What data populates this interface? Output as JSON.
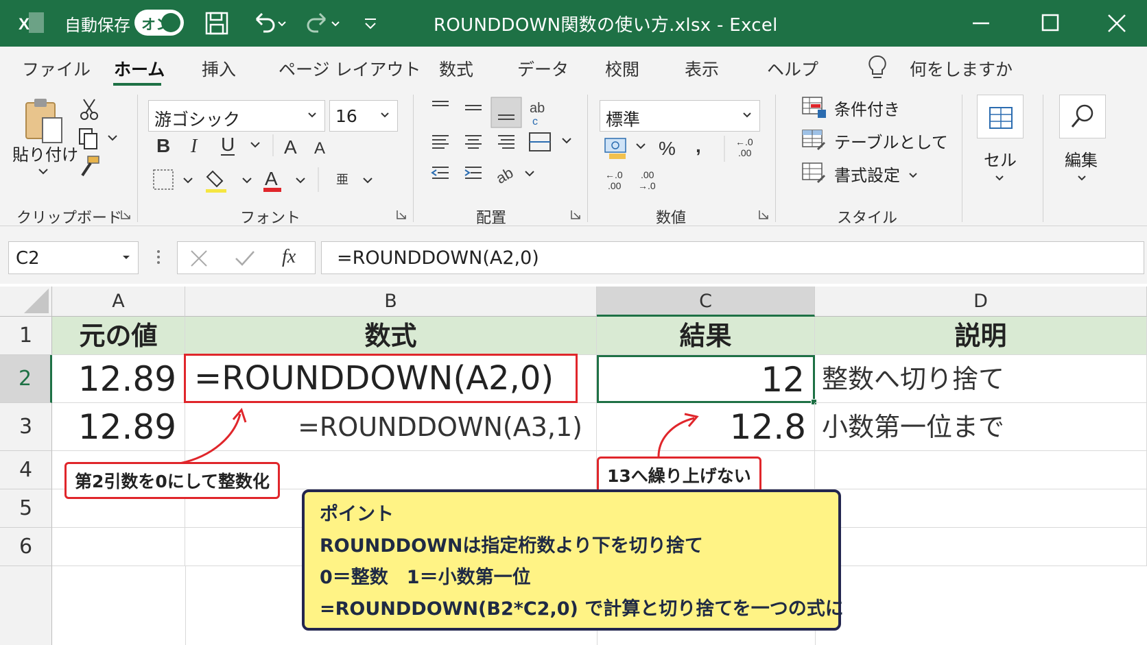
{
  "titlebar": {
    "autosave_label": "自動保存",
    "autosave_state": "オン",
    "doc_title": "ROUNDDOWN関数の使い方.xlsx  -  Excel"
  },
  "tabs": [
    {
      "label": "ファイル"
    },
    {
      "label": "ホーム"
    },
    {
      "label": "挿入"
    },
    {
      "label": "ページ レイアウト"
    },
    {
      "label": "数式"
    },
    {
      "label": "データ"
    },
    {
      "label": "校閲"
    },
    {
      "label": "表示"
    },
    {
      "label": "ヘルプ"
    },
    {
      "label": "何をしますか"
    }
  ],
  "ribbon": {
    "clipboard": {
      "paste_label": "貼り付け",
      "group_label": "クリップボード"
    },
    "font": {
      "font_name": "游ゴシック",
      "font_size": "16",
      "group_label": "フォント"
    },
    "alignment": {
      "group_label": "配置"
    },
    "number": {
      "format": "標準",
      "group_label": "数値"
    },
    "styles": {
      "conditional": "条件付き",
      "as_table": "テーブルとして",
      "cell_styles": "書式設定",
      "group_label": "スタイル"
    },
    "cells": {
      "label": "セル"
    },
    "editing": {
      "label": "編集"
    }
  },
  "formula_bar": {
    "name_box": "C2",
    "fx": "fx",
    "formula": "=ROUNDDOWN(A2,0)"
  },
  "sheet": {
    "columns": [
      "A",
      "B",
      "C",
      "D"
    ],
    "rows": [
      "1",
      "2",
      "3",
      "4",
      "5",
      "6"
    ],
    "header_row": [
      "元の値",
      "数式",
      "結果",
      "説明"
    ],
    "data_rows": [
      {
        "a": "12.89",
        "b": "=ROUNDDOWN(A2,0)",
        "c": "12",
        "d": "整数へ切り捨て"
      },
      {
        "a": "12.89",
        "b": "=ROUNDDOWN(A3,1)",
        "c": "12.8",
        "d": "小数第一位まで"
      }
    ]
  },
  "callouts": {
    "left": "第2引数を0にして整数化",
    "right": "13へ繰り上げない"
  },
  "point_box": {
    "title": "ポイント",
    "line1": "ROUNDDOWNは指定桁数より下を切り捨て",
    "line2": "0＝整数　1＝小数第一位",
    "line3": "=ROUNDDOWN(B2*C2,0) で計算と切り捨てを一つの式に"
  },
  "colors": {
    "excel_green": "#1e7145",
    "header_fill": "#d9ead3",
    "callout_red": "#e0262b",
    "point_fill": "#fff385",
    "point_border": "#23264f"
  }
}
